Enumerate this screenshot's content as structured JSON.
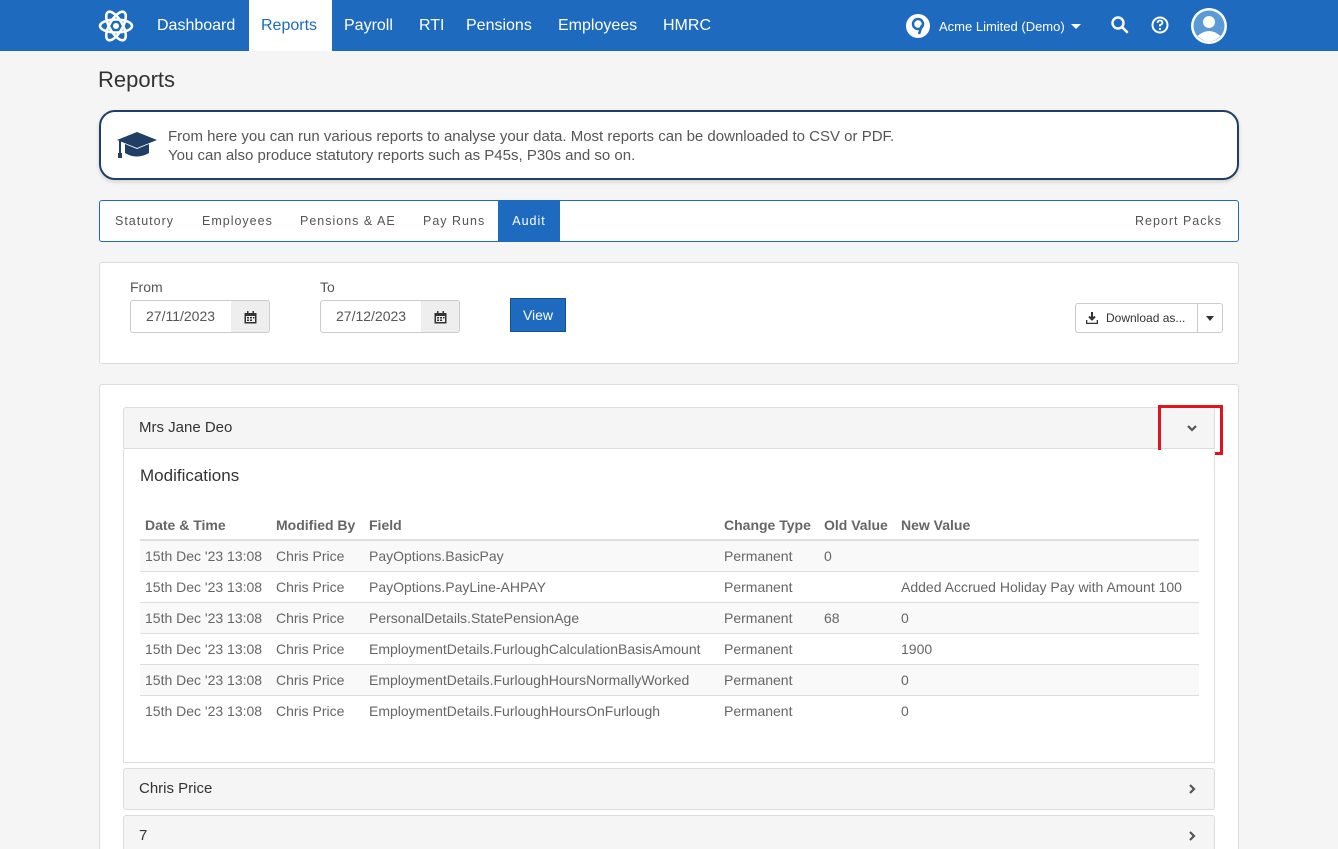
{
  "nav": {
    "items": [
      "Dashboard",
      "Reports",
      "Payroll",
      "RTI",
      "Pensions",
      "Employees",
      "HMRC"
    ],
    "active": "Reports",
    "company": "Acme Limited (Demo)"
  },
  "page_title": "Reports",
  "callout": {
    "line1": "From here you can run various reports to analyse your data. Most reports can be downloaded to CSV or PDF.",
    "line2": "You can also produce statutory reports such as P45s, P30s and so on."
  },
  "tabs": [
    "Statutory",
    "Employees",
    "Pensions & AE",
    "Pay Runs",
    "Audit"
  ],
  "active_tab": "Audit",
  "report_packs": "Report Packs",
  "filter": {
    "from_label": "From",
    "from_value": "27/11/2023",
    "to_label": "To",
    "to_value": "27/12/2023",
    "view_label": "View",
    "download_label": "Download as..."
  },
  "accordion": [
    {
      "title": "Mrs Jane Deo",
      "expanded": true
    },
    {
      "title": "Chris Price",
      "expanded": false
    },
    {
      "title": "7",
      "expanded": false
    }
  ],
  "modifications": {
    "title": "Modifications",
    "columns": [
      "Date & Time",
      "Modified By",
      "Field",
      "Change Type",
      "Old Value",
      "New Value"
    ],
    "rows": [
      [
        "15th Dec '23 13:08",
        "Chris Price",
        "PayOptions.BasicPay",
        "Permanent",
        "0",
        ""
      ],
      [
        "15th Dec '23 13:08",
        "Chris Price",
        "PayOptions.PayLine-AHPAY",
        "Permanent",
        "",
        "Added Accrued Holiday Pay with Amount 100"
      ],
      [
        "15th Dec '23 13:08",
        "Chris Price",
        "PersonalDetails.StatePensionAge",
        "Permanent",
        "68",
        "0"
      ],
      [
        "15th Dec '23 13:08",
        "Chris Price",
        "EmploymentDetails.FurloughCalculationBasisAmount",
        "Permanent",
        "",
        "1900"
      ],
      [
        "15th Dec '23 13:08",
        "Chris Price",
        "EmploymentDetails.FurloughHoursNormallyWorked",
        "Permanent",
        "",
        "0"
      ],
      [
        "15th Dec '23 13:08",
        "Chris Price",
        "EmploymentDetails.FurloughHoursOnFurlough",
        "Permanent",
        "",
        "0"
      ]
    ]
  },
  "colors": {
    "brand": "#1d6abf",
    "highlight": "#e0141e"
  }
}
